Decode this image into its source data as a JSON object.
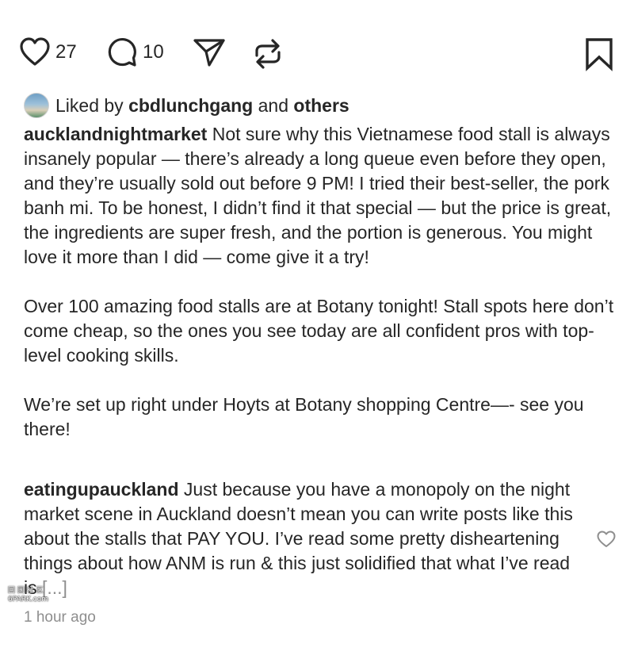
{
  "actions": {
    "like_count": "27",
    "comment_count": "10"
  },
  "liked_by": {
    "prefix": "Liked by ",
    "user": "cbdlunchgang",
    "middle": " and ",
    "others": "others"
  },
  "caption": {
    "username": "aucklandnightmarket",
    "paragraphs": [
      " Not sure why this Vietnamese food stall is always insanely popular — there’s already a long queue even before they open, and they’re usually sold out before 9 PM! I tried their best-seller, the pork banh mi. To be honest, I didn’t find it that special — but the price is great, the ingredients are super fresh, and the portion is generous. You might love it more than I did — come give it a try!",
      "Over 100 amazing food stalls are at Botany tonight! Stall spots here don’t come cheap, so the ones you see today are all confident pros with top-level cooking skills.",
      "We’re set up right under Hoyts at Botany shopping Centre—- see you there!"
    ]
  },
  "comment": {
    "username": "eatingupauckland",
    "text": " Just because you have a monopoly on the night market scene in Auckland doesn’t mean you can write posts like this about the stalls that PAY YOU. I’ve read some pretty disheartening things about how ANM is run & this just solidified that what I’ve read is ",
    "more": "[...]",
    "timestamp": "1 hour ago"
  },
  "watermark": {
    "line1": "回 国 社 区",
    "line2": "6PARK.com"
  },
  "icons": {
    "like": "heart-icon",
    "comment": "comment-bubble-icon",
    "share": "paper-plane-icon",
    "repost": "repost-icon",
    "save": "bookmark-icon",
    "comment_like": "heart-outline-icon"
  },
  "colors": {
    "text": "#262626",
    "muted": "#8e8e8e"
  }
}
